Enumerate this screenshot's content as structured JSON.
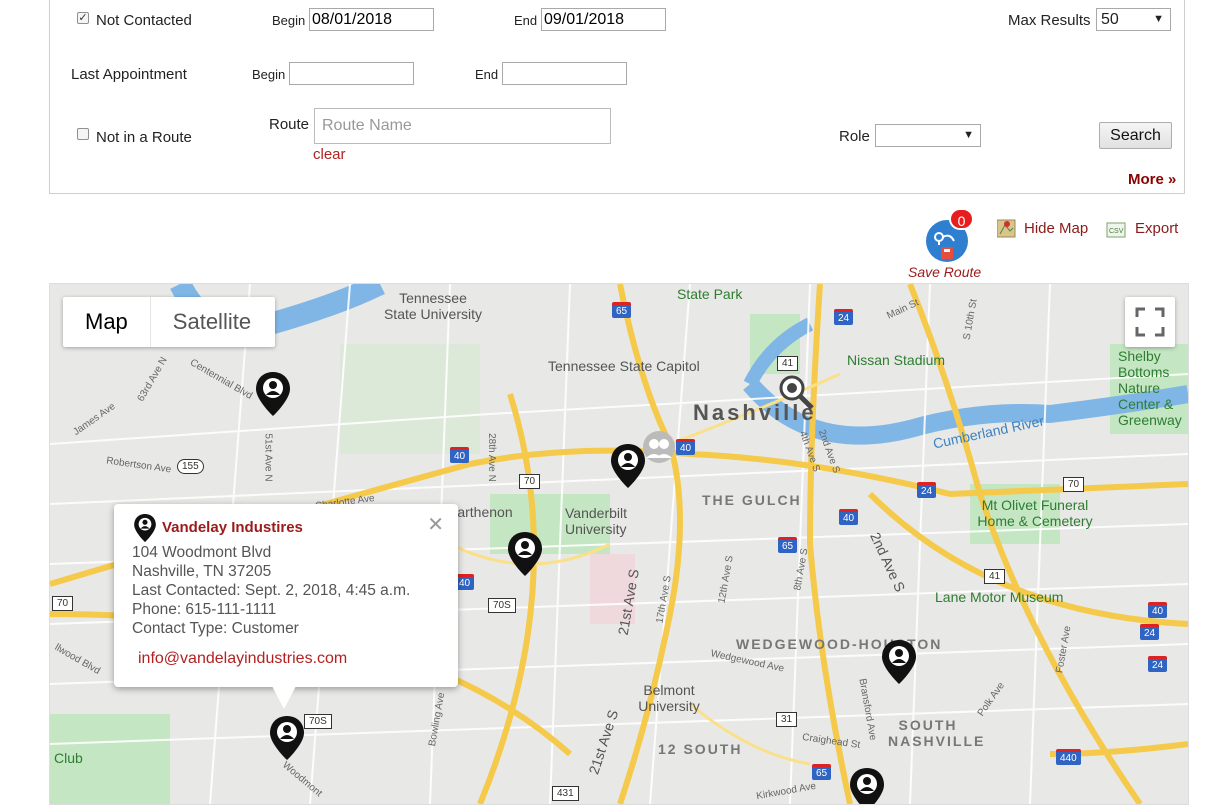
{
  "filters": {
    "not_contacted_label": "Not Contacted",
    "not_contacted_checked": true,
    "begin_label": "Begin",
    "begin_value": "08/01/2018",
    "end_label": "End",
    "end_value": "09/01/2018",
    "max_results_label": "Max Results",
    "max_results_value": "50",
    "last_appt_label": "Last Appointment",
    "last_begin_label": "Begin",
    "last_end_label": "End",
    "not_in_route_label": "Not in a Route",
    "route_label": "Route",
    "route_placeholder": "Route Name",
    "clear_label": "clear",
    "role_label": "Role",
    "search_label": "Search",
    "more_label": "More »"
  },
  "toolbar": {
    "route_badge_count": "0",
    "save_route_label": "Save Route",
    "hide_map_label": "Hide Map",
    "export_label": "Export"
  },
  "map": {
    "map_tab": "Map",
    "satellite_tab": "Satellite",
    "labels": {
      "tsu": "Tennessee State University",
      "state_park": "State Park",
      "capitol": "Tennessee State Capitol",
      "nissan": "Nissan Stadium",
      "nashville": "Nashville",
      "shelby": "Shelby Bottoms Nature Center & Greenway",
      "cumberland": "Cumberland River",
      "gulch": "THE GULCH",
      "parthenon": "Parthenon",
      "vanderbilt": "Vanderbilt University",
      "olivet": "Mt Olivet Funeral Home & Cemetery",
      "lane": "Lane Motor Museum",
      "wedgewood": "WEDGEWOOD-HOUSTON",
      "belmont": "Belmont University",
      "twelve_south": "12 SOUTH",
      "south_nashville": "SOUTH NASHVILLE",
      "club": "Club",
      "robertson": "Robertson Ave",
      "centennial": "Centennial Blvd",
      "james": "James Ave",
      "ave63": "63rd Ave N",
      "ave51": "51st Ave N",
      "ave28": "28th Ave N",
      "ave21": "21st Ave S",
      "ave2": "2nd Ave S",
      "ave17": "17th Ave S",
      "ave12": "12th Ave S",
      "ave8": "8th Ave S",
      "main": "Main St",
      "craighead": "Craighead St",
      "kirkwood": "Kirkwood Ave",
      "polk": "Polk Ave",
      "foster": "Foster Ave",
      "bransford": "Bransford Ave",
      "bowling": "Bowling Ave",
      "woodmont": "Woodmont",
      "wedgewood_ave": "Wedgewood Ave",
      "lwood": "llwood Blvd",
      "s10": "S 10th St",
      "ave4": "4th Ave S",
      "ave2b": "2nd Ave S",
      "charlotte": "Charlotte Ave"
    },
    "shields": {
      "i65a": "65",
      "i24a": "24",
      "r41": "41",
      "r155": "155",
      "i40a": "40",
      "i40b": "40",
      "r70a": "70",
      "i24b": "24",
      "r70b": "70",
      "i40c": "40",
      "i65b": "65",
      "r41b": "41",
      "i40d": "40",
      "i24c": "24",
      "i24d": "24",
      "r70c": "70",
      "r70s": "70S",
      "i40e": "40",
      "r31": "31",
      "r70s2": "70S",
      "i440": "440",
      "i65c": "65",
      "r431": "431"
    }
  },
  "popup": {
    "title": "Vandelay Industires",
    "address": "104 Woodmont Blvd",
    "city": "Nashville, TN 37205",
    "last_contacted": "Last Contacted: Sept. 2, 2018, 4:45 a.m.",
    "phone": "Phone: 615-111-1111",
    "contact_type": "Contact Type: Customer",
    "email": "info@vandelayindustries.com"
  },
  "colors": {
    "accent_red": "#b22222",
    "map_bg": "#e8e8e6",
    "water": "#7fb6e6",
    "park": "#c4e6c2",
    "highway": "#f5c94a"
  }
}
